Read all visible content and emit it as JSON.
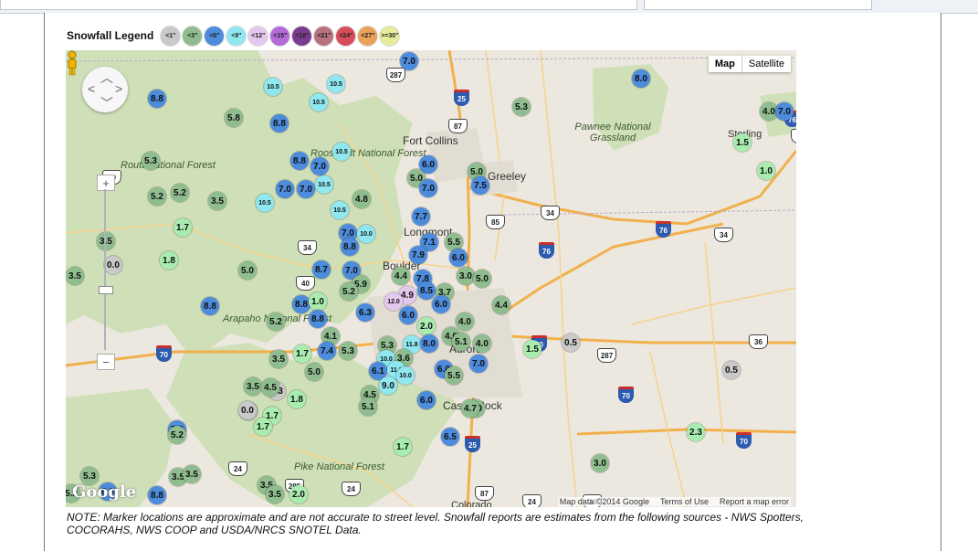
{
  "legend": {
    "title": "Snowfall Legend",
    "chips": [
      {
        "label": "<1\"",
        "color": "#c9c9c9"
      },
      {
        "label": "<3\"",
        "color": "#8fbd8f"
      },
      {
        "label": "<6\"",
        "color": "#4d8bdc"
      },
      {
        "label": "<9\"",
        "color": "#8fe8f0"
      },
      {
        "label": "<12\"",
        "color": "#e3c8ee"
      },
      {
        "label": "<15\"",
        "color": "#b46ad8"
      },
      {
        "label": "<18\"",
        "color": "#7a3b8e"
      },
      {
        "label": "<21\"",
        "color": "#b8727f"
      },
      {
        "label": "<24\"",
        "color": "#d94c5b"
      },
      {
        "label": "<27\"",
        "color": "#e8a25a"
      },
      {
        "label": ">=30\"",
        "color": "#e6ec9a"
      }
    ]
  },
  "map": {
    "type_control": {
      "map": "Map",
      "satellite": "Satellite"
    },
    "watermark": "Google",
    "attribution": {
      "data": "Map data ©2014 Google",
      "terms": "Terms of Use",
      "report": "Report a map error"
    },
    "places": [
      {
        "name": "Fort Collins",
        "big": true
      },
      {
        "name": "Greeley",
        "big": true
      },
      {
        "name": "Longmont",
        "big": true
      },
      {
        "name": "Boulder",
        "big": true
      },
      {
        "name": "Aurora",
        "big": true
      },
      {
        "name": "Castle Rock",
        "big": true
      },
      {
        "name": "Sterling",
        "big": false
      },
      {
        "name": "Colorado",
        "big": false
      },
      {
        "name": "Pawnee National Grassland",
        "park": true
      },
      {
        "name": "Roosevelt National Forest",
        "park": true
      },
      {
        "name": "Routt National Forest",
        "park": true
      },
      {
        "name": "Arapaho National Forest",
        "park": true
      },
      {
        "name": "Pike National Forest",
        "park": true
      }
    ],
    "markers": [
      {
        "v": "7.0",
        "c": "#4d8bdc"
      },
      {
        "v": "8.8",
        "c": "#4d8bdc"
      },
      {
        "v": "10.5",
        "c": "#8fe8f0"
      },
      {
        "v": "10.5",
        "c": "#8fe8f0"
      },
      {
        "v": "10.5",
        "c": "#8fe8f0"
      },
      {
        "v": "5.8",
        "c": "#8fbd8f"
      },
      {
        "v": "8.8",
        "c": "#4d8bdc"
      },
      {
        "v": "8.0",
        "c": "#4d8bdc"
      },
      {
        "v": "5.3",
        "c": "#8fbd8f"
      },
      {
        "v": "4.0",
        "c": "#8fbd8f"
      },
      {
        "v": "7.0",
        "c": "#4d8bdc"
      },
      {
        "v": "1.5",
        "c": "#a9ecb0"
      },
      {
        "v": "1.0",
        "c": "#a9ecb0"
      },
      {
        "v": "5.3",
        "c": "#8fbd8f"
      },
      {
        "v": "8.8",
        "c": "#4d8bdc"
      },
      {
        "v": "7.0",
        "c": "#4d8bdc"
      },
      {
        "v": "10.5",
        "c": "#8fe8f0"
      },
      {
        "v": "6.0",
        "c": "#4d8bdc"
      },
      {
        "v": "5.0",
        "c": "#8fbd8f"
      },
      {
        "v": "7.0",
        "c": "#4d8bdc"
      },
      {
        "v": "5.0",
        "c": "#8fbd8f"
      },
      {
        "v": "7.5",
        "c": "#4d8bdc"
      },
      {
        "v": "5.2",
        "c": "#8fbd8f"
      },
      {
        "v": "5.2",
        "c": "#8fbd8f"
      },
      {
        "v": "3.5",
        "c": "#8fbd8f"
      },
      {
        "v": "10.5",
        "c": "#8fe8f0"
      },
      {
        "v": "7.0",
        "c": "#4d8bdc"
      },
      {
        "v": "7.0",
        "c": "#4d8bdc"
      },
      {
        "v": "10.5",
        "c": "#8fe8f0"
      },
      {
        "v": "4.8",
        "c": "#8fbd8f"
      },
      {
        "v": "10.5",
        "c": "#8fe8f0"
      },
      {
        "v": "7.7",
        "c": "#4d8bdc"
      },
      {
        "v": "1.7",
        "c": "#a9ecb0"
      },
      {
        "v": "7.0",
        "c": "#4d8bdc"
      },
      {
        "v": "10.0",
        "c": "#8fe8f0"
      },
      {
        "v": "7.1",
        "c": "#4d8bdc"
      },
      {
        "v": "5.5",
        "c": "#8fbd8f"
      },
      {
        "v": "3.5",
        "c": "#8fbd8f"
      },
      {
        "v": "0.0",
        "c": "#c9c9c9"
      },
      {
        "v": "8.8",
        "c": "#4d8bdc"
      },
      {
        "v": "7.9",
        "c": "#4d8bdc"
      },
      {
        "v": "6.0",
        "c": "#4d8bdc"
      },
      {
        "v": "1.8",
        "c": "#a9ecb0"
      },
      {
        "v": "3.5",
        "c": "#8fbd8f"
      },
      {
        "v": "5.0",
        "c": "#8fbd8f"
      },
      {
        "v": "8.7",
        "c": "#4d8bdc"
      },
      {
        "v": "7.0",
        "c": "#4d8bdc"
      },
      {
        "v": "4.4",
        "c": "#8fbd8f"
      },
      {
        "v": "7.8",
        "c": "#4d8bdc"
      },
      {
        "v": "3.0",
        "c": "#8fbd8f"
      },
      {
        "v": "5.0",
        "c": "#8fbd8f"
      },
      {
        "v": "5.9",
        "c": "#8fbd8f"
      },
      {
        "v": "4.9",
        "c": "#e3c8ee"
      },
      {
        "v": "8.5",
        "c": "#4d8bdc"
      },
      {
        "v": "3.7",
        "c": "#8fbd8f"
      },
      {
        "v": "5.2",
        "c": "#8fbd8f"
      },
      {
        "v": "12.0",
        "c": "#e3c8ee"
      },
      {
        "v": "6.0",
        "c": "#4d8bdc"
      },
      {
        "v": "4.4",
        "c": "#8fbd8f"
      },
      {
        "v": "8.8",
        "c": "#4d8bdc"
      },
      {
        "v": "8.8",
        "c": "#4d8bdc"
      },
      {
        "v": "1.0",
        "c": "#a9ecb0"
      },
      {
        "v": "6.3",
        "c": "#4d8bdc"
      },
      {
        "v": "6.0",
        "c": "#4d8bdc"
      },
      {
        "v": "4.0",
        "c": "#8fbd8f"
      },
      {
        "v": "5.2",
        "c": "#8fbd8f"
      },
      {
        "v": "8.8",
        "c": "#4d8bdc"
      },
      {
        "v": "2.0",
        "c": "#a9ecb0"
      },
      {
        "v": "4.1",
        "c": "#8fbd8f"
      },
      {
        "v": "7.4",
        "c": "#4d8bdc"
      },
      {
        "v": "5.3",
        "c": "#8fbd8f"
      },
      {
        "v": "5.3",
        "c": "#8fbd8f"
      },
      {
        "v": "11.8",
        "c": "#8fe8f0"
      },
      {
        "v": "8.0",
        "c": "#4d8bdc"
      },
      {
        "v": "4.0",
        "c": "#8fbd8f"
      },
      {
        "v": "4.0",
        "c": "#8fbd8f"
      },
      {
        "v": "5.1",
        "c": "#8fbd8f"
      },
      {
        "v": "1.5",
        "c": "#a9ecb0"
      },
      {
        "v": "0.5",
        "c": "#c9c9c9"
      },
      {
        "v": "3.5",
        "c": "#8fbd8f"
      },
      {
        "v": "1.7",
        "c": "#a9ecb0"
      },
      {
        "v": "5.0",
        "c": "#8fbd8f"
      },
      {
        "v": "10.0",
        "c": "#8fe8f0"
      },
      {
        "v": "3.6",
        "c": "#8fbd8f"
      },
      {
        "v": "7.0",
        "c": "#4d8bdc"
      },
      {
        "v": "6.1",
        "c": "#4d8bdc"
      },
      {
        "v": "11.0",
        "c": "#8fe8f0"
      },
      {
        "v": "6.0",
        "c": "#4d8bdc"
      },
      {
        "v": "10.0",
        "c": "#8fe8f0"
      },
      {
        "v": "5.5",
        "c": "#8fbd8f"
      },
      {
        "v": "4.5",
        "c": "#8fbd8f"
      },
      {
        "v": "3.5",
        "c": "#8fbd8f"
      },
      {
        "v": "0.3",
        "c": "#c9c9c9"
      },
      {
        "v": "9.0",
        "c": "#8fe8f0"
      },
      {
        "v": "1.8",
        "c": "#a9ecb0"
      },
      {
        "v": "4.5",
        "c": "#8fbd8f"
      },
      {
        "v": "5.1",
        "c": "#8fbd8f"
      },
      {
        "v": "6.0",
        "c": "#4d8bdc"
      },
      {
        "v": "3.0",
        "c": "#8fbd8f"
      },
      {
        "v": "0.5",
        "c": "#c9c9c9"
      },
      {
        "v": "0.0",
        "c": "#c9c9c9"
      },
      {
        "v": "1.7",
        "c": "#a9ecb0"
      },
      {
        "v": "1.7",
        "c": "#a9ecb0"
      },
      {
        "v": "7.0",
        "c": "#4d8bdc"
      },
      {
        "v": "5.2",
        "c": "#8fbd8f"
      },
      {
        "v": "6.5",
        "c": "#4d8bdc"
      },
      {
        "v": "2.3",
        "c": "#a9ecb0"
      },
      {
        "v": "1.7",
        "c": "#a9ecb0"
      },
      {
        "v": "3.0",
        "c": "#8fbd8f"
      },
      {
        "v": "5.3",
        "c": "#8fbd8f"
      },
      {
        "v": "3.5",
        "c": "#8fbd8f"
      },
      {
        "v": "3.5",
        "c": "#8fbd8f"
      },
      {
        "v": "8.8",
        "c": "#4d8bdc"
      },
      {
        "v": "2.0",
        "c": "#a9ecb0"
      },
      {
        "v": "3.5",
        "c": "#8fbd8f"
      },
      {
        "v": "3.5",
        "c": "#8fbd8f"
      },
      {
        "v": "0.0",
        "c": "#c9c9c9"
      },
      {
        "v": "4.7",
        "c": "#8fbd8f"
      },
      {
        "v": "6.6",
        "c": "#4d8bdc"
      },
      {
        "v": "5.2",
        "c": "#8fbd8f"
      }
    ],
    "shields": [
      {
        "t": "287",
        "k": "us"
      },
      {
        "t": "25",
        "k": "i"
      },
      {
        "t": "87",
        "k": "us"
      },
      {
        "t": "76",
        "k": "i"
      },
      {
        "t": "6",
        "k": "us"
      },
      {
        "t": "40",
        "k": "us"
      },
      {
        "t": "34",
        "k": "us"
      },
      {
        "t": "85",
        "k": "us"
      },
      {
        "t": "34",
        "k": "us"
      },
      {
        "t": "76",
        "k": "i"
      },
      {
        "t": "34",
        "k": "us"
      },
      {
        "t": "76",
        "k": "i"
      },
      {
        "t": "40",
        "k": "us"
      },
      {
        "t": "36",
        "k": "us"
      },
      {
        "t": "70",
        "k": "i"
      },
      {
        "t": "70",
        "k": "i"
      },
      {
        "t": "287",
        "k": "us"
      },
      {
        "t": "70",
        "k": "i"
      },
      {
        "t": "25",
        "k": "i"
      },
      {
        "t": "70",
        "k": "i"
      },
      {
        "t": "24",
        "k": "us"
      },
      {
        "t": "285",
        "k": "us"
      },
      {
        "t": "24",
        "k": "us"
      },
      {
        "t": "87",
        "k": "us"
      },
      {
        "t": "24",
        "k": "us"
      },
      {
        "t": "34",
        "k": "us"
      }
    ]
  },
  "note": "NOTE: Marker locations are approximate and are not accurate to street level. Snowfall reports are estimates from the following sources - NWS Spotters, COCORAHS, NWS COOP and USDA/NRCS SNOTEL Data."
}
